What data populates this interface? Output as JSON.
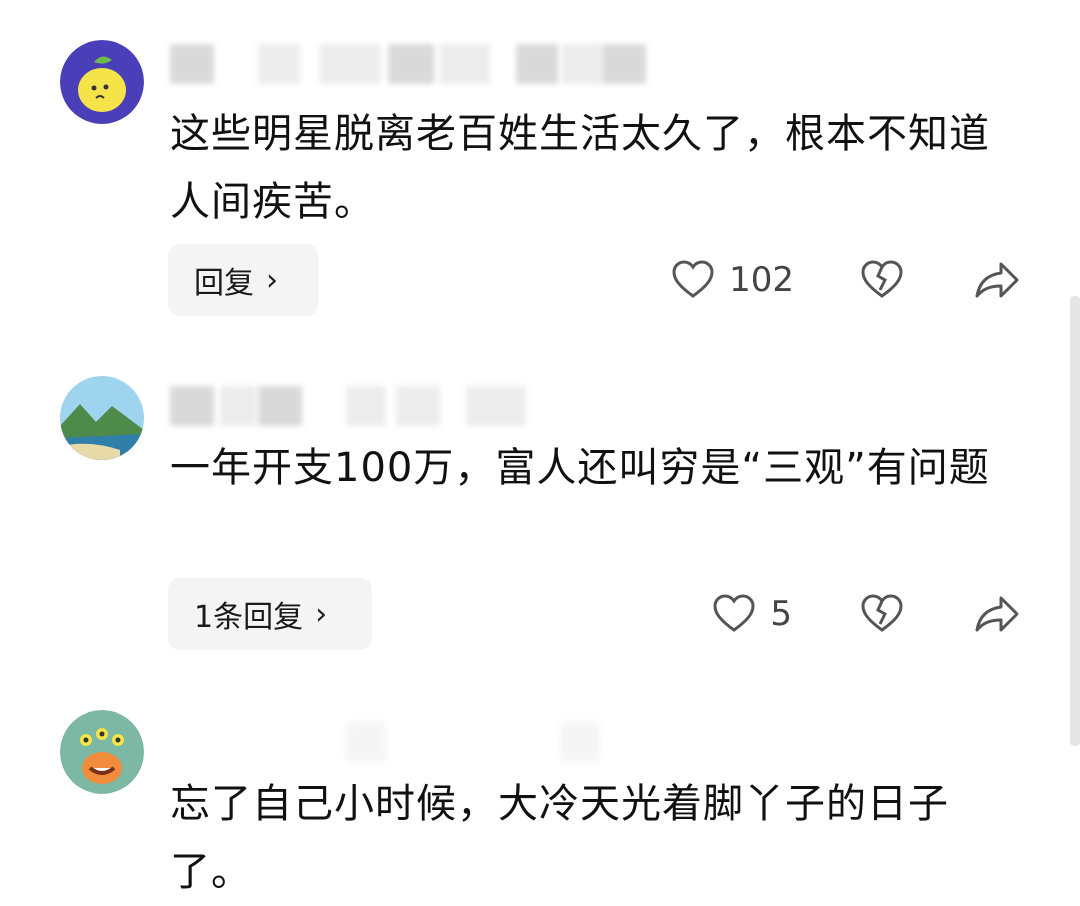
{
  "comments": [
    {
      "text": "这些明星脱离老百姓生活太久了，根本不知道人间疾苦。",
      "reply_label": "回复",
      "like_count": "102",
      "avatar_icon": "lemon-avatar-icon"
    },
    {
      "text": "一年开支100万，富人还叫穷是“三观”有问题",
      "reply_label": "1条回复",
      "like_count": "5",
      "avatar_icon": "landscape-avatar-icon"
    },
    {
      "text": "忘了自己小时候，大冷天光着脚丫子的日子了。",
      "avatar_icon": "monster-avatar-icon"
    }
  ],
  "icons": {
    "like": "heart-outline-icon",
    "dislike": "broken-heart-icon",
    "share": "share-arrow-icon",
    "chevron": "chevron-right-icon"
  },
  "colors": {
    "reply_bg": "#f4f4f4",
    "icon_gray": "#555555"
  }
}
